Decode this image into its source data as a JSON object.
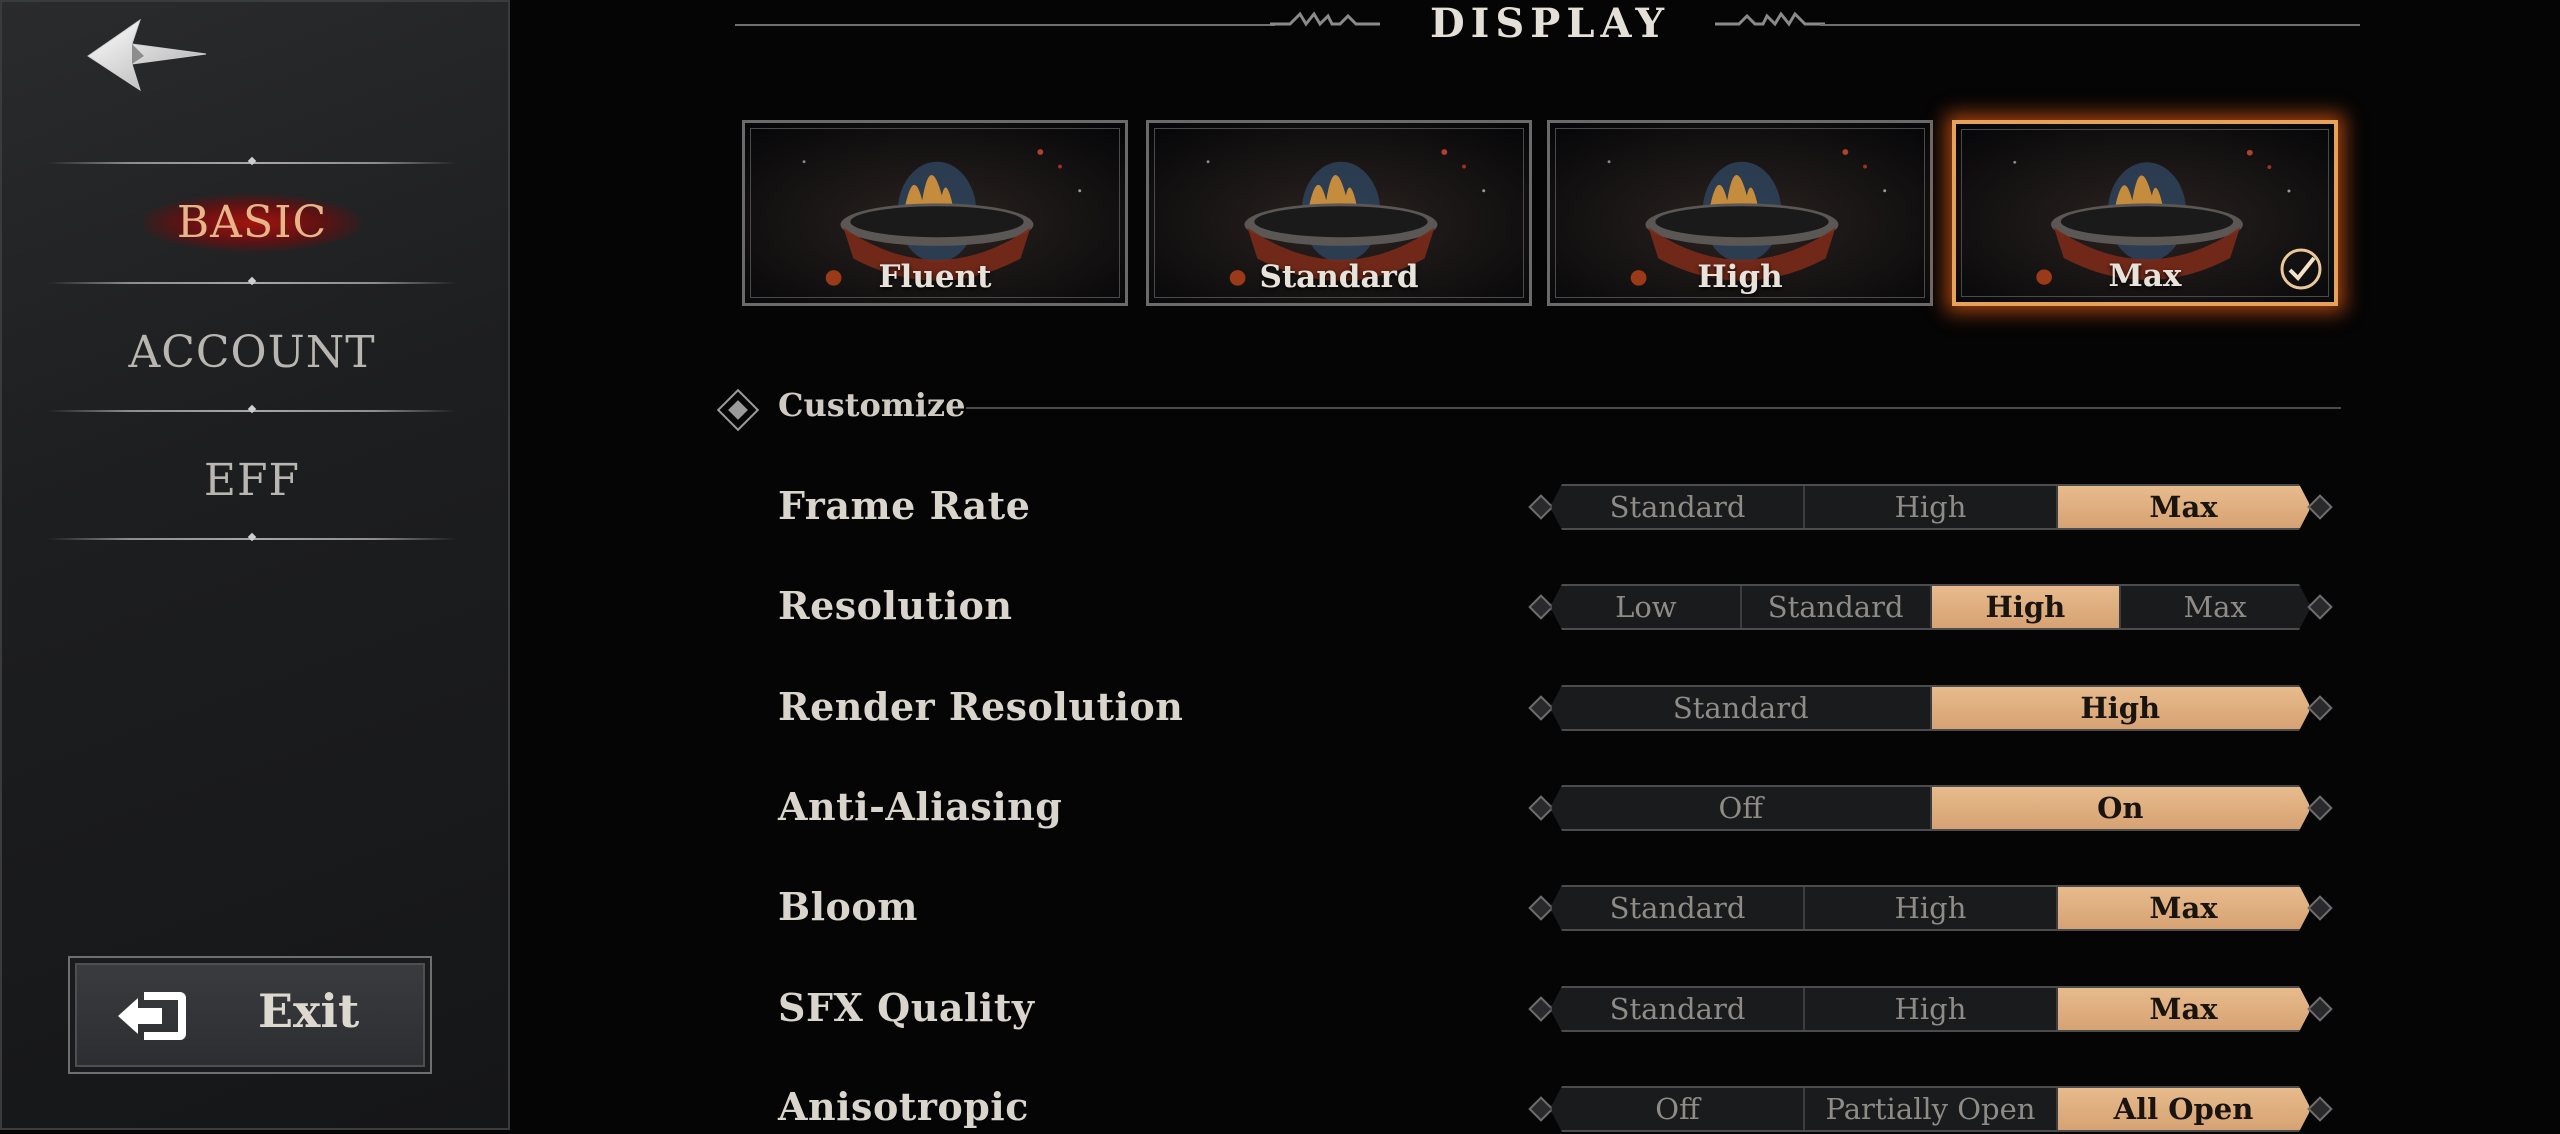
{
  "sidebar": {
    "items": [
      {
        "label": "BASIC",
        "active": true
      },
      {
        "label": "ACCOUNT",
        "active": false
      },
      {
        "label": "EFF",
        "active": false
      }
    ],
    "exit_label": "Exit",
    "back_icon": "back-arrow-icon",
    "exit_icon": "exit-door-icon"
  },
  "header": {
    "title": "DISPLAY"
  },
  "presets": [
    {
      "label": "Fluent",
      "selected": false
    },
    {
      "label": "Standard",
      "selected": false
    },
    {
      "label": "High",
      "selected": false
    },
    {
      "label": "Max",
      "selected": true
    }
  ],
  "customize": {
    "label": "Customize"
  },
  "settings": [
    {
      "label": "Frame Rate",
      "options": [
        "Standard",
        "High",
        "Max"
      ],
      "selected": 2
    },
    {
      "label": "Resolution",
      "options": [
        "Low",
        "Standard",
        "High",
        "Max"
      ],
      "selected": 2
    },
    {
      "label": "Render Resolution",
      "options": [
        "Standard",
        "High"
      ],
      "selected": 1
    },
    {
      "label": "Anti-Aliasing",
      "options": [
        "Off",
        "On"
      ],
      "selected": 1
    },
    {
      "label": "Bloom",
      "options": [
        "Standard",
        "High",
        "Max"
      ],
      "selected": 2
    },
    {
      "label": "SFX Quality",
      "options": [
        "Standard",
        "High",
        "Max"
      ],
      "selected": 2
    },
    {
      "label": "Anisotropic",
      "options": [
        "Off",
        "Partially Open",
        "All Open"
      ],
      "selected": 2
    }
  ],
  "colors": {
    "accent": "#e7bb8c",
    "active_nav": "#e8b48a",
    "preset_selected_border": "#e7a259",
    "background": "#050505"
  }
}
